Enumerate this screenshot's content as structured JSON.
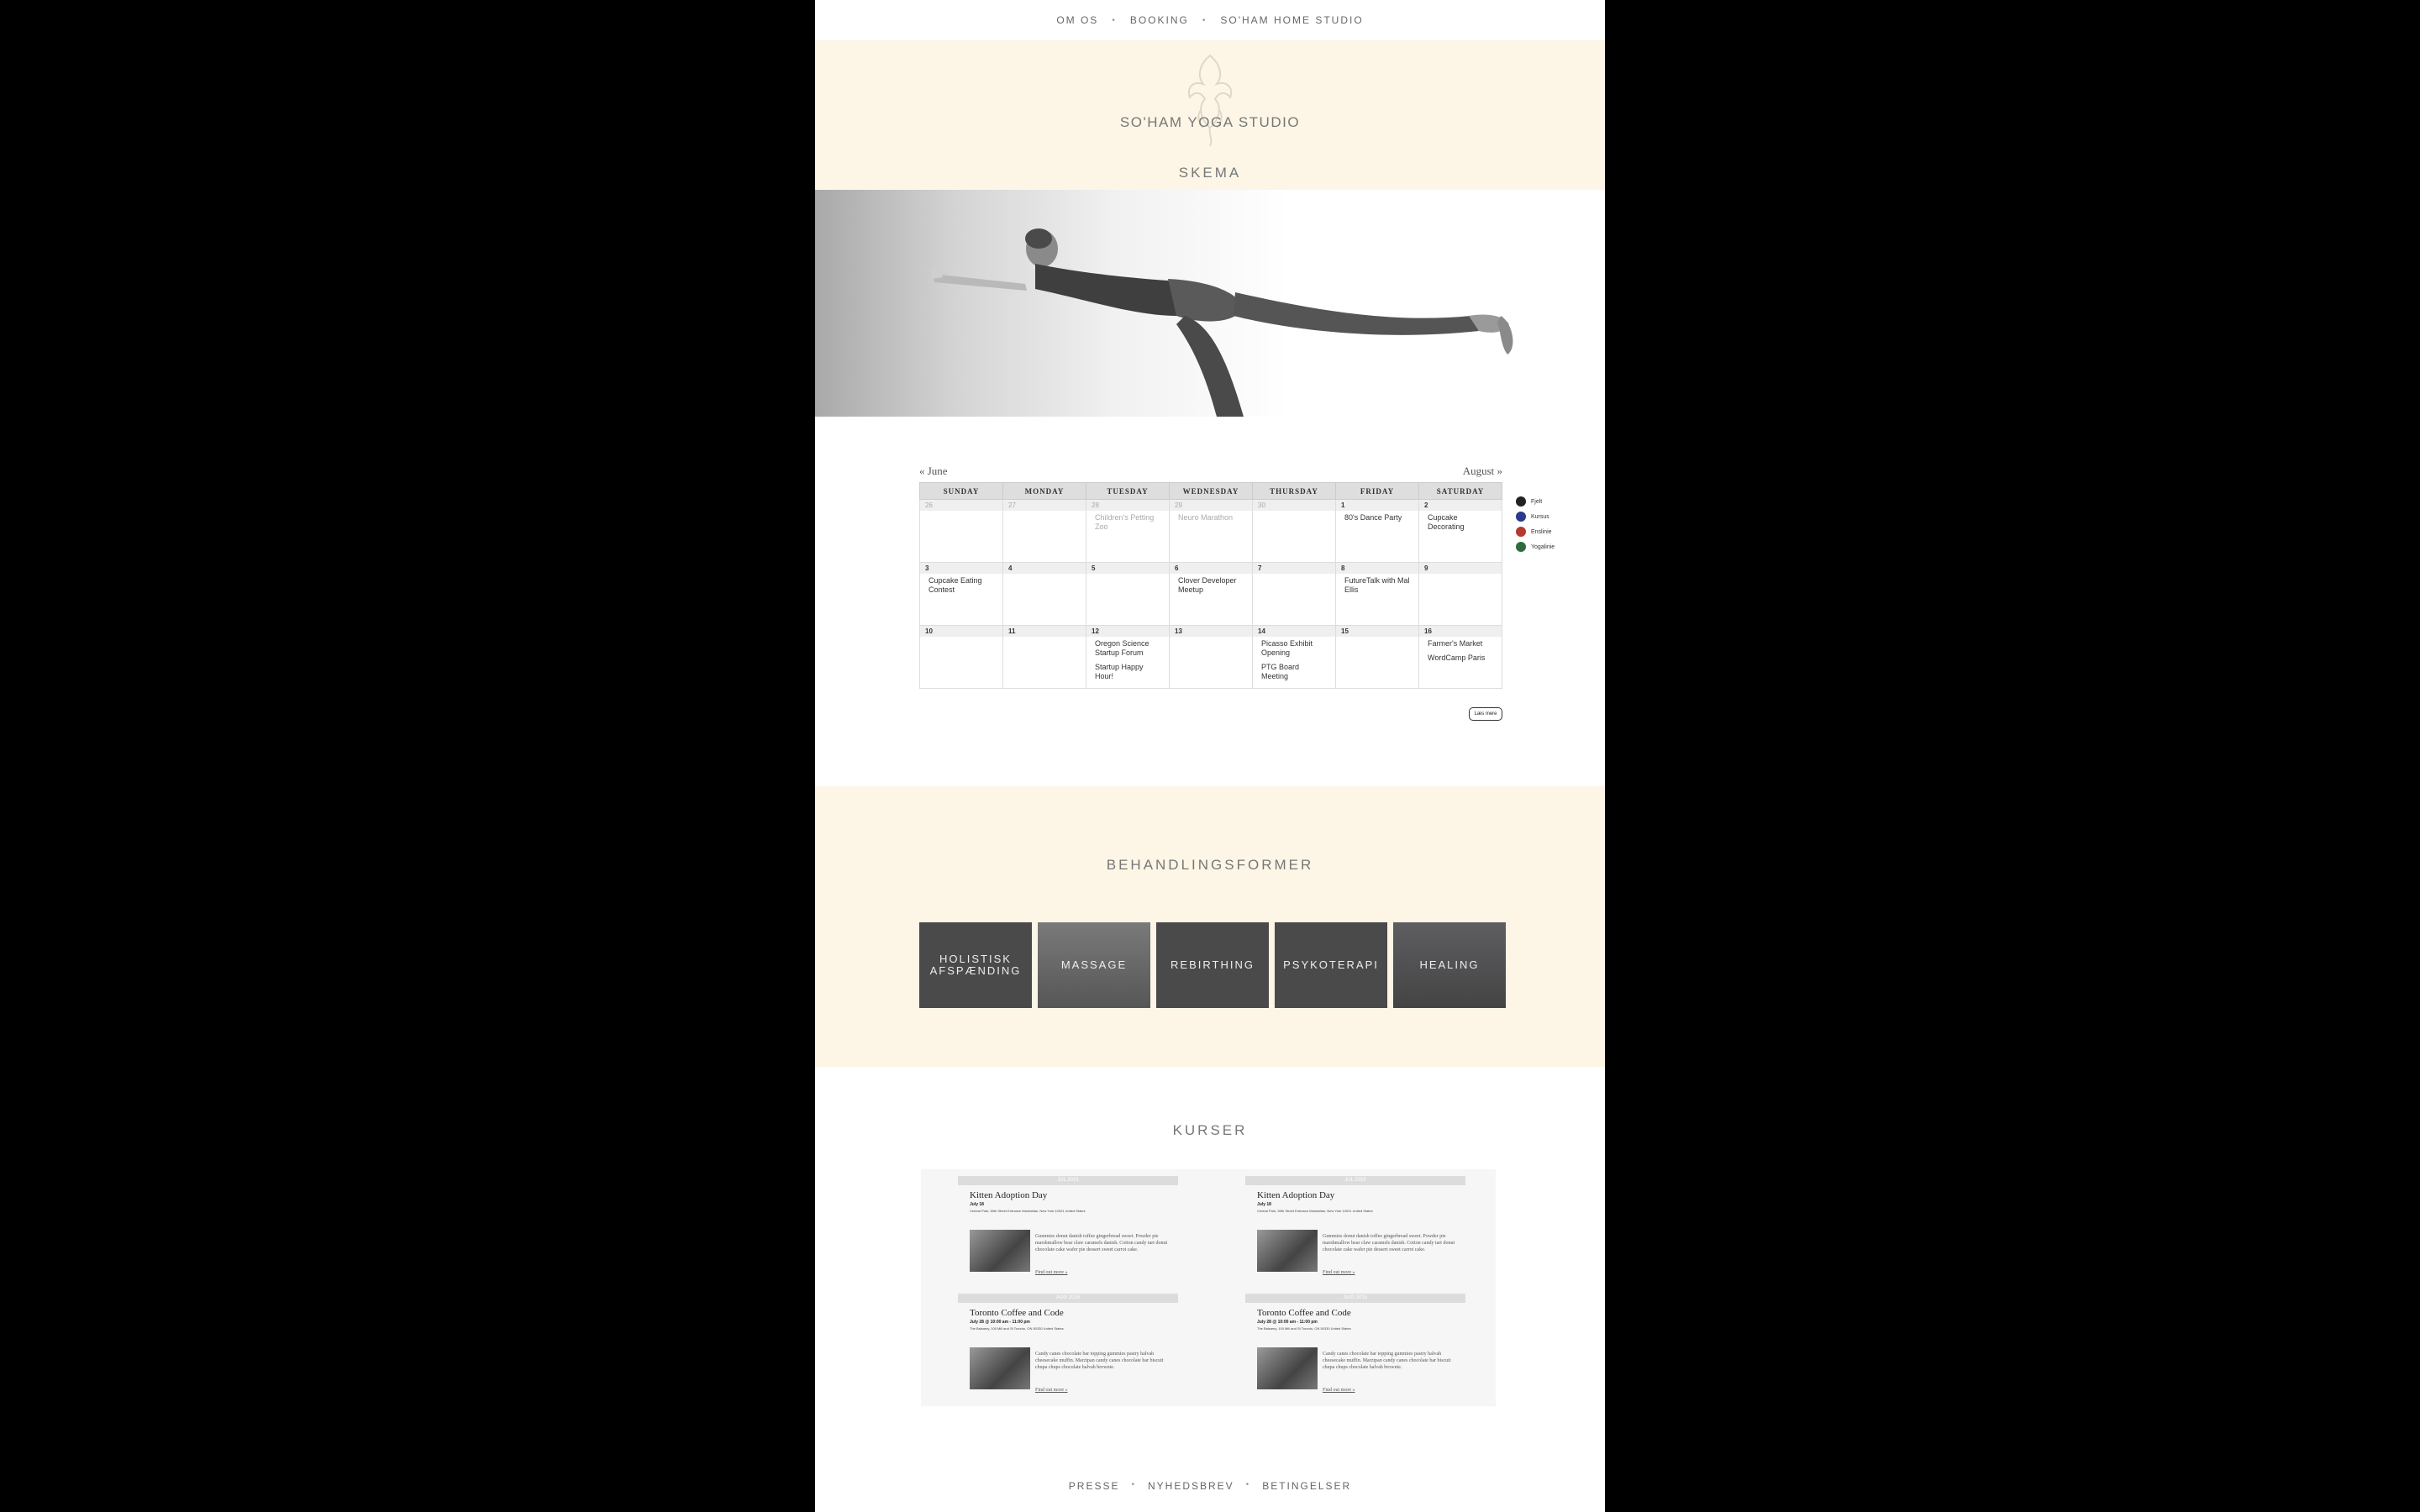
{
  "top_nav": {
    "items": [
      "OM OS",
      "BOOKING",
      "SO'HAM HOME STUDIO"
    ],
    "separator": "•"
  },
  "header": {
    "studio_name": "SO'HAM YOGA STUDIO",
    "section_title": "SKEMA",
    "logo_icon": "phoenix-logo"
  },
  "colors": {
    "cream": "#fdf6e6",
    "text": "#555555"
  },
  "calendar": {
    "prev_label": "« June",
    "next_label": "August »",
    "weekdays": [
      "SUNDAY",
      "MONDAY",
      "TUESDAY",
      "WEDNESDAY",
      "THURSDAY",
      "FRIDAY",
      "SATURDAY"
    ],
    "weeks": [
      [
        {
          "day": "26",
          "muted": true,
          "events": []
        },
        {
          "day": "27",
          "muted": true,
          "events": []
        },
        {
          "day": "28",
          "muted": true,
          "events": [
            {
              "text": "Children's Petting Zoo",
              "muted": true
            }
          ]
        },
        {
          "day": "29",
          "muted": true,
          "events": [
            {
              "text": "Neuro Marathon",
              "muted": true
            }
          ]
        },
        {
          "day": "30",
          "muted": true,
          "events": []
        },
        {
          "day": "1",
          "muted": false,
          "events": [
            {
              "text": "80's Dance Party",
              "muted": false
            }
          ]
        },
        {
          "day": "2",
          "muted": false,
          "events": [
            {
              "text": "Cupcake Decorating",
              "muted": false
            }
          ]
        }
      ],
      [
        {
          "day": "3",
          "muted": false,
          "events": [
            {
              "text": "Cupcake Eating Contest",
              "muted": false
            }
          ]
        },
        {
          "day": "4",
          "muted": false,
          "events": []
        },
        {
          "day": "5",
          "muted": false,
          "events": []
        },
        {
          "day": "6",
          "muted": false,
          "events": [
            {
              "text": "Clover Developer Meetup",
              "muted": false
            }
          ]
        },
        {
          "day": "7",
          "muted": false,
          "events": []
        },
        {
          "day": "8",
          "muted": false,
          "events": [
            {
              "text": "FutureTalk with Mal Ellis",
              "muted": false
            }
          ]
        },
        {
          "day": "9",
          "muted": false,
          "events": []
        }
      ],
      [
        {
          "day": "10",
          "muted": false,
          "events": []
        },
        {
          "day": "11",
          "muted": false,
          "events": []
        },
        {
          "day": "12",
          "muted": false,
          "events": [
            {
              "text": "Oregon Science Startup Forum",
              "muted": false
            },
            {
              "text": "Startup Happy Hour!",
              "muted": false
            }
          ]
        },
        {
          "day": "13",
          "muted": false,
          "events": []
        },
        {
          "day": "14",
          "muted": false,
          "events": [
            {
              "text": "Picasso Exhibit Opening",
              "muted": false
            },
            {
              "text": "PTG Board Meeting",
              "muted": false
            }
          ]
        },
        {
          "day": "15",
          "muted": false,
          "events": []
        },
        {
          "day": "16",
          "muted": false,
          "events": [
            {
              "text": "Farmer's Market",
              "muted": false
            },
            {
              "text": "WordCamp Paris",
              "muted": false
            }
          ]
        }
      ]
    ],
    "legend": [
      {
        "label": "Fjelt",
        "color": "#222222"
      },
      {
        "label": "Kursus",
        "color": "#2b3a8c"
      },
      {
        "label": "Enslinie",
        "color": "#b33a2e"
      },
      {
        "label": "Yogalinie",
        "color": "#2f6b3e"
      }
    ],
    "load_more": "Læs mere"
  },
  "behandling": {
    "title": "BEHANDLINGSFORMER",
    "tiles": [
      "HOLISTISK AFSPÆNDING",
      "MASSAGE",
      "REBIRTHING",
      "PSYKOTERAPI",
      "HEALING"
    ]
  },
  "kurser": {
    "title": "KURSER",
    "cards": [
      {
        "bar": "JUL 2015",
        "title": "Kitten Adoption Day",
        "date": "July 18",
        "address": "Central Park, 59th Street Entrance Manhattan, New York 10021 United States",
        "desc": "Gummies donut danish toffee gingerbread sweet. Powder pie marshmallow bear claw caramels danish. Cotton candy tart donut chocolate cake wafer pie dessert sweet carrot cake.",
        "more": "Find out more »"
      },
      {
        "bar": "JUL 2015",
        "title": "Kitten Adoption Day",
        "date": "July 18",
        "address": "Central Park, 59th Street Entrance Manhattan, New York 10021 United States",
        "desc": "Gummies donut danish toffee gingerbread sweet. Powder pie marshmallow bear claw caramels danish. Cotton candy tart donut chocolate cake wafer pie dessert sweet carrot cake.",
        "more": "Find out more »"
      },
      {
        "bar": "AUG 2015",
        "title": "Toronto Coffee and Code",
        "date": "July 28 @ 10:00 am - 11:00 pm",
        "address": "The Balsamy, 100 Mill and St Toronto, ON 50330 United States",
        "desc": "Candy canes chocolate bar topping gummies pastry halvah cheesecake muffin. Marzipan candy canes chocolate bar biscuit chupa chups chocolate halvah brownie.",
        "more": "Find out more »"
      },
      {
        "bar": "AUG 2015",
        "title": "Toronto Coffee and Code",
        "date": "July 28 @ 10:00 am - 11:00 pm",
        "address": "The Balsamy, 100 Mill and St Toronto, ON 50330 United States",
        "desc": "Candy canes chocolate bar topping gummies pastry halvah cheesecake muffin. Marzipan candy canes chocolate bar biscuit chupa chups chocolate halvah brownie.",
        "more": "Find out more »"
      }
    ]
  },
  "footer_nav": {
    "items": [
      "PRESSE",
      "NYHEDSBREV",
      "BETINGELSER"
    ],
    "separator": "•"
  }
}
